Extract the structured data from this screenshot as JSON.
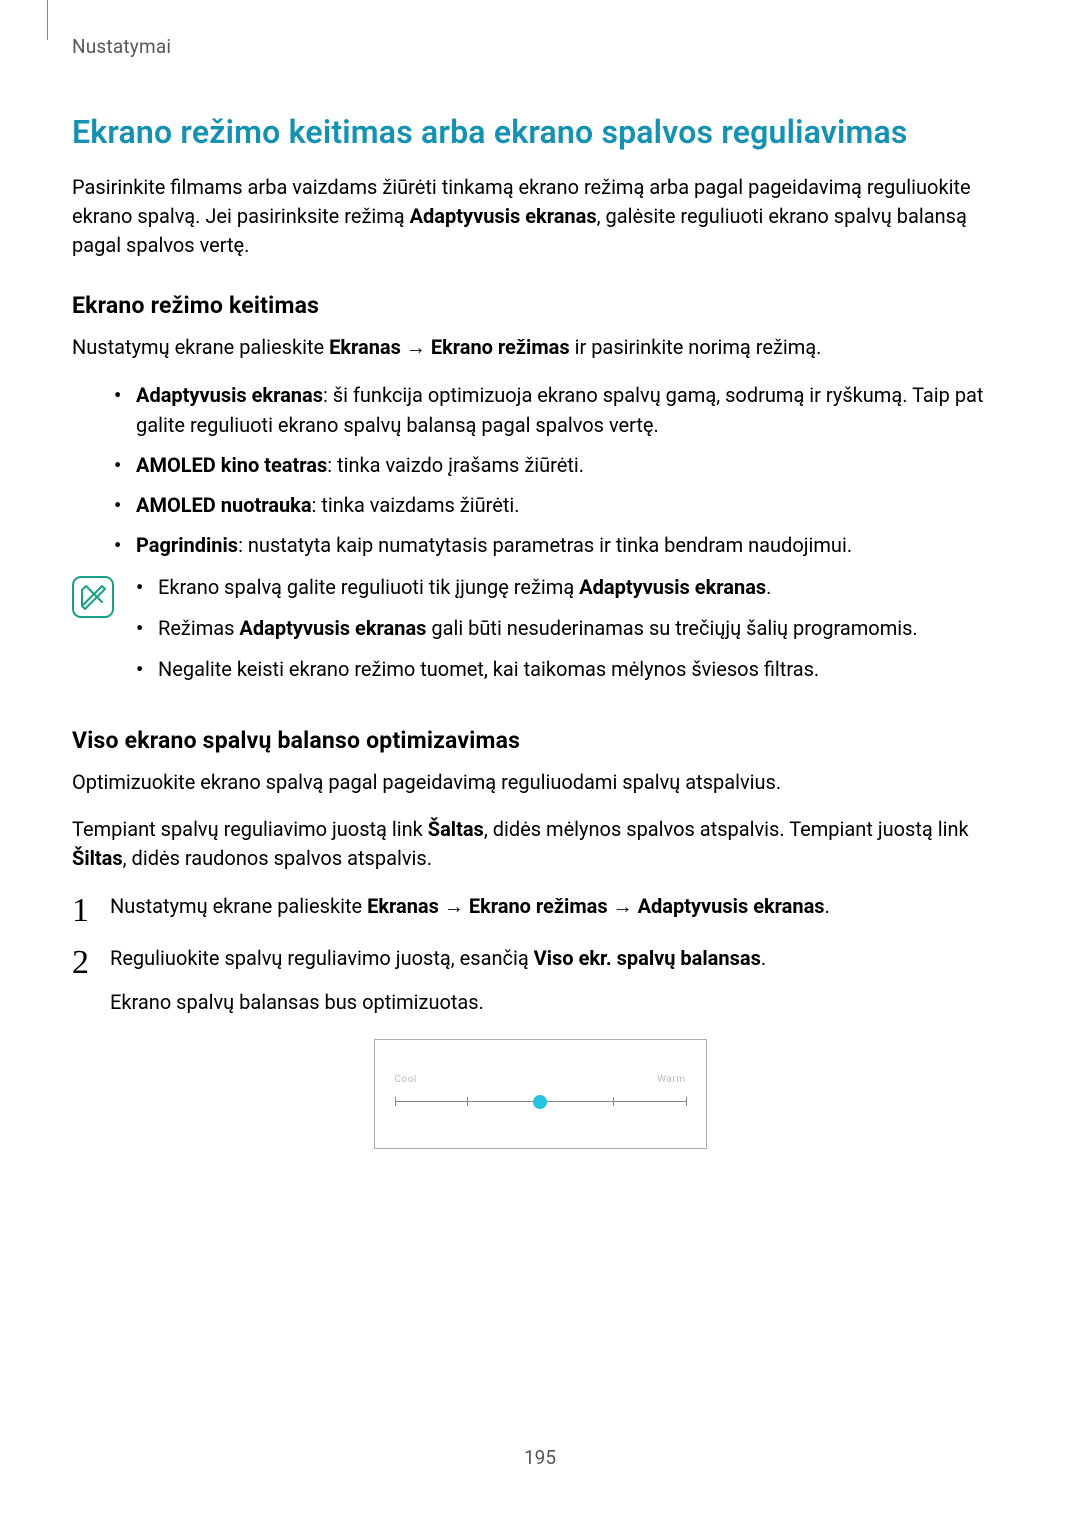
{
  "header": "Nustatymai",
  "page_number": "195",
  "h1": "Ekrano režimo keitimas arba ekrano spalvos reguliavimas",
  "intro_parts": [
    "Pasirinkite filmams arba vaizdams žiūrėti tinkamą ekrano režimą arba pagal pageidavimą reguliuokite ekrano spalvą. Jei pasirinksite režimą ",
    "Adaptyvusis ekranas",
    ", galėsite reguliuoti ekrano spalvų balansą pagal spalvos vertę."
  ],
  "section1": {
    "heading": "Ekrano režimo keitimas",
    "line_parts": [
      "Nustatymų ekrane palieskite ",
      "Ekranas",
      " → ",
      "Ekrano režimas",
      " ir pasirinkite norimą režimą."
    ],
    "items": [
      {
        "bold": "Adaptyvusis ekranas",
        "rest": ": ši funkcija optimizuoja ekrano spalvų gamą, sodrumą ir ryškumą. Taip pat galite reguliuoti ekrano spalvų balansą pagal spalvos vertę."
      },
      {
        "bold": "AMOLED kino teatras",
        "rest": ": tinka vaizdo įrašams žiūrėti."
      },
      {
        "bold": "AMOLED nuotrauka",
        "rest": ": tinka vaizdams žiūrėti."
      },
      {
        "bold": "Pagrindinis",
        "rest": ": nustatyta kaip numatytasis parametras ir tinka bendram naudojimui."
      }
    ],
    "notes": [
      {
        "pre": "Ekrano spalvą galite reguliuoti tik įjungę režimą ",
        "bold": "Adaptyvusis ekranas",
        "post": "."
      },
      {
        "pre": "Režimas ",
        "bold": "Adaptyvusis ekranas",
        "post": " gali būti nesuderinamas su trečiųjų šalių programomis."
      },
      {
        "pre": "Negalite keisti ekrano režimo tuomet, kai taikomas mėlynos šviesos filtras.",
        "bold": "",
        "post": ""
      }
    ]
  },
  "section2": {
    "heading": "Viso ekrano spalvų balanso optimizavimas",
    "p1": "Optimizuokite ekrano spalvą pagal pageidavimą reguliuodami spalvų atspalvius.",
    "p2_parts": [
      "Tempiant spalvų reguliavimo juostą link ",
      "Šaltas",
      ", didės mėlynos spalvos atspalvis. Tempiant juostą link ",
      "Šiltas",
      ", didės raudonos spalvos atspalvis."
    ],
    "step1_parts": [
      "Nustatymų ekrane palieskite ",
      "Ekranas",
      " → ",
      "Ekrano režimas",
      " → ",
      "Adaptyvusis ekranas",
      "."
    ],
    "step2_parts": [
      "Reguliuokite spalvų reguliavimo juostą, esančią ",
      "Viso ekr. spalvų balansas",
      "."
    ],
    "step2_sub": "Ekrano spalvų balansas bus optimizuotas."
  },
  "slider": {
    "left_label": "Cool",
    "right_label": "Warm",
    "handle_percent": 50
  }
}
